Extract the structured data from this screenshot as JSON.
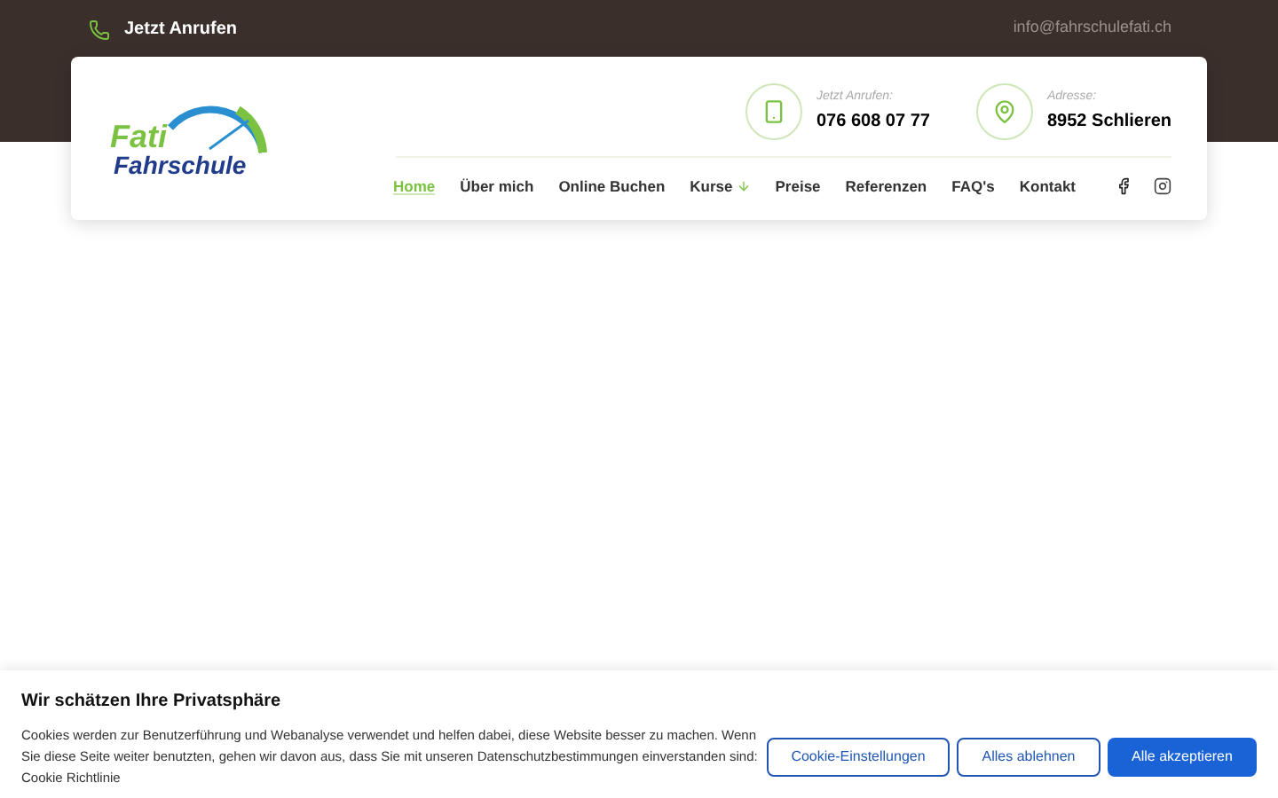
{
  "topbar": {
    "call_label": "Jetzt Anrufen",
    "email": "info@fahrschulefati.ch"
  },
  "logo": {
    "line_1": "Fati",
    "line_2": "Fahrschule"
  },
  "contacts": [
    {
      "kind": "phone",
      "label": "Jetzt Anrufen:",
      "value": "076 608 07 77"
    },
    {
      "kind": "address",
      "label": "Adresse:",
      "value": "8952 Schlieren"
    }
  ],
  "nav": [
    {
      "label": "Home",
      "selected": true,
      "dropdown": false
    },
    {
      "label": "Über mich",
      "selected": false,
      "dropdown": false
    },
    {
      "label": "Online Buchen",
      "selected": false,
      "dropdown": false
    },
    {
      "label": "Kurse",
      "selected": false,
      "dropdown": true
    },
    {
      "label": "Preise",
      "selected": false,
      "dropdown": false
    },
    {
      "label": "Referenzen",
      "selected": false,
      "dropdown": false
    },
    {
      "label": "FAQ's",
      "selected": false,
      "dropdown": false
    },
    {
      "label": "Kontakt",
      "selected": false,
      "dropdown": false
    }
  ],
  "social": [
    {
      "kind": "facebook"
    },
    {
      "kind": "instagram"
    }
  ],
  "cookie_banner": {
    "title": "Wir schätzen Ihre Privatsphäre",
    "text": "Cookies werden zur Benutzerführung und Webanalyse verwendet und helfen dabei, diese Website besser zu machen. Wenn Sie diese Seite weiter benutzten, gehen wir davon aus, dass Sie mit unseren Datenschutzbestimmungen einverstanden sind:",
    "link": "Cookie Richtlinie",
    "buttons": [
      {
        "label": "Cookie-Einstellungen",
        "kind": "outline"
      },
      {
        "label": "Alles ablehnen",
        "kind": "outline"
      },
      {
        "label": "Alle akzeptieren",
        "kind": "primary"
      }
    ]
  }
}
